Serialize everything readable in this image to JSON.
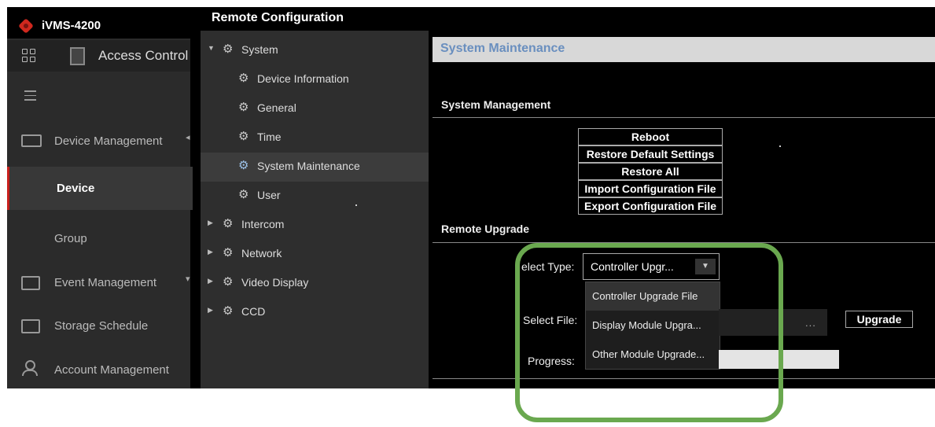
{
  "app": {
    "title": "iVMS-4200",
    "module": "Access Control"
  },
  "nav": {
    "items": [
      {
        "label": "Device Management",
        "icon": "device-icon"
      },
      {
        "label": "Device",
        "active": true
      },
      {
        "label": "Group"
      },
      {
        "label": "Event Management",
        "icon": "event-icon"
      },
      {
        "label": "Storage Schedule",
        "icon": "storage-icon"
      },
      {
        "label": "Account Management",
        "icon": "account-icon"
      }
    ]
  },
  "tree": {
    "title": "Remote Configuration",
    "items": [
      {
        "label": "System"
      },
      {
        "label": "Device Information"
      },
      {
        "label": "General"
      },
      {
        "label": "Time"
      },
      {
        "label": "System Maintenance"
      },
      {
        "label": "User"
      },
      {
        "label": "Intercom"
      },
      {
        "label": "Network"
      },
      {
        "label": "Video Display"
      },
      {
        "label": "CCD"
      }
    ]
  },
  "panel": {
    "title": "System Maintenance",
    "management": {
      "title": "System Management",
      "buttons": [
        "Reboot",
        "Restore Default Settings",
        "Restore All",
        "Import Configuration File",
        "Export Configuration File"
      ]
    },
    "upgrade": {
      "title": "Remote Upgrade",
      "select_type_label": "elect Type:",
      "select_type_value": "Controller Upgr...",
      "options": [
        "Controller Upgrade File",
        "Display Module Upgra...",
        "Other Module Upgrade..."
      ],
      "select_file_label": "Select File:",
      "browse_label": "...",
      "upgrade_button": "Upgrade",
      "progress_label": "Progress:",
      "progress": 0
    }
  },
  "colors": {
    "accent": "#c8201c",
    "highlight_ring": "#6aa84f",
    "panel_title": "#6a8fbf"
  }
}
